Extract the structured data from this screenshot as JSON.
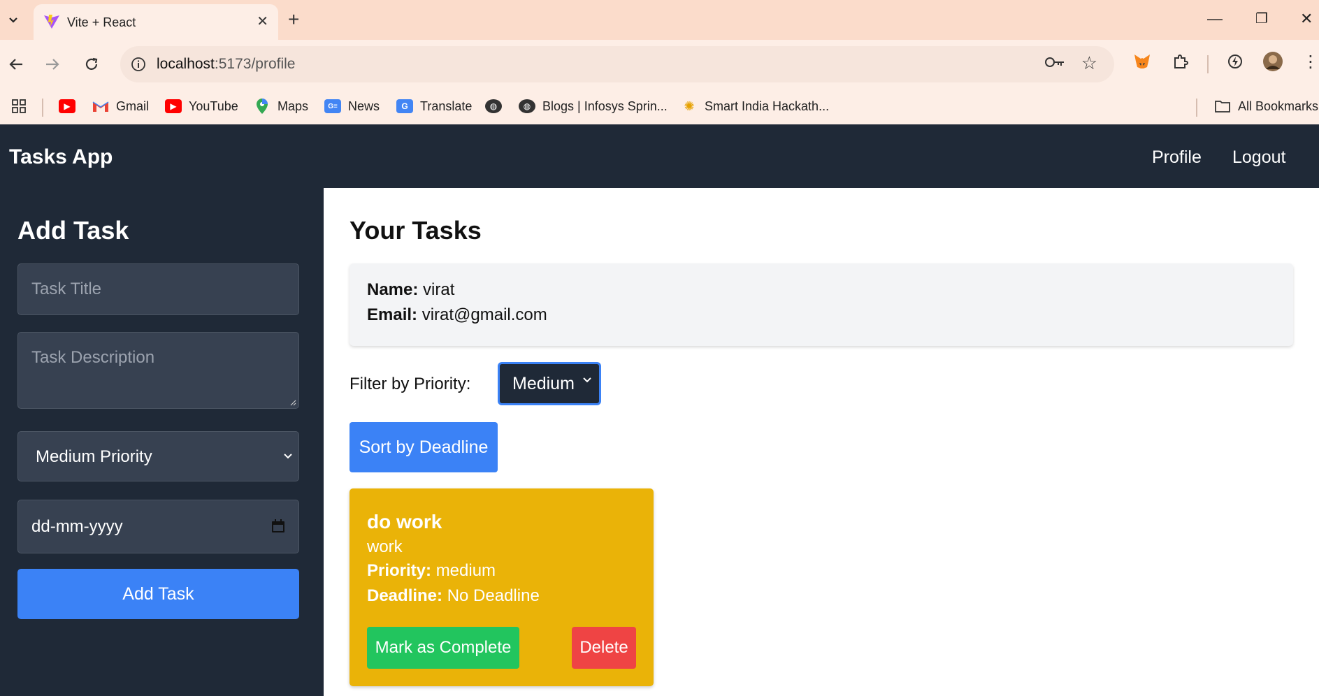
{
  "browser": {
    "tab_title": "Vite + React",
    "url_host": "localhost",
    "url_path": ":5173/profile",
    "bookmarks": [
      {
        "label": "",
        "icon": "youtube-icon"
      },
      {
        "label": "Gmail",
        "icon": "gmail-icon"
      },
      {
        "label": "YouTube",
        "icon": "youtube-icon"
      },
      {
        "label": "Maps",
        "icon": "maps-icon"
      },
      {
        "label": "News",
        "icon": "news-icon"
      },
      {
        "label": "Translate",
        "icon": "translate-icon"
      },
      {
        "label": "",
        "icon": "globe-icon"
      },
      {
        "label": "Blogs | Infosys Sprin...",
        "icon": "globe-icon"
      },
      {
        "label": "Smart India Hackath...",
        "icon": "bulb-icon"
      }
    ],
    "all_bookmarks_label": "All Bookmarks"
  },
  "app": {
    "title": "Tasks App",
    "nav": {
      "profile": "Profile",
      "logout": "Logout"
    }
  },
  "sidebar": {
    "heading": "Add Task",
    "title_placeholder": "Task Title",
    "description_placeholder": "Task Description",
    "priority_value": "Medium Priority",
    "date_placeholder": "dd-mm-yyyy",
    "add_button": "Add Task"
  },
  "main": {
    "heading": "Your Tasks",
    "profile": {
      "name_label": "Name:",
      "name_value": "virat",
      "email_label": "Email:",
      "email_value": "virat@gmail.com"
    },
    "filter_label": "Filter by Priority:",
    "filter_value": "Medium",
    "sort_button": "Sort by Deadline",
    "tasks": [
      {
        "title": "do work",
        "description": "work",
        "priority_label": "Priority:",
        "priority_value": "medium",
        "deadline_label": "Deadline:",
        "deadline_value": "No Deadline",
        "complete_button": "Mark as Complete",
        "delete_button": "Delete",
        "card_color": "#eab308"
      }
    ]
  },
  "colors": {
    "header_bg": "#1f2937",
    "accent_blue": "#3b82f6",
    "success_green": "#22c55e",
    "danger_red": "#ef4444"
  }
}
